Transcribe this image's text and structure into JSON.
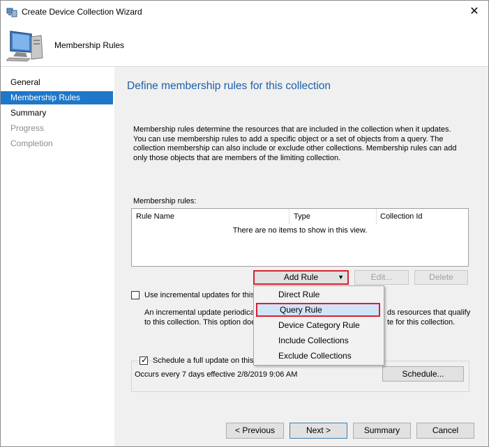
{
  "window": {
    "title": "Create Device Collection Wizard",
    "close_glyph": "✕"
  },
  "header": {
    "icon": "computer-icon",
    "title": "Membership Rules"
  },
  "nav": {
    "items": [
      {
        "label": "General",
        "state": "normal"
      },
      {
        "label": "Membership Rules",
        "state": "active"
      },
      {
        "label": "Summary",
        "state": "normal"
      },
      {
        "label": "Progress",
        "state": "disabled"
      },
      {
        "label": "Completion",
        "state": "disabled"
      }
    ]
  },
  "main": {
    "title": "Define membership rules for this collection",
    "description": "Membership rules determine the resources that are included in the collection when it updates. You can use membership rules to add a specific object or a set of objects from a query. The collection membership can also include or exclude other collections. Membership rules can add only those objects that are members of the limiting collection.",
    "rules_label": "Membership rules:",
    "columns": [
      "Rule Name",
      "Type",
      "Collection Id"
    ],
    "empty_text": "There are no items to show in this view.",
    "add_rule": "Add Rule",
    "edit": "Edit...",
    "delete": "Delete",
    "incremental_label": "Use incremental updates for this c",
    "incremental_desc_line1": "An incremental update periodical",
    "incremental_desc_line1_tail": "ds resources that qualify",
    "incremental_desc_line2": "to this collection. This option doe",
    "incremental_desc_line2_tail": "te for this collection.",
    "schedule_check_label": "Schedule a full update on this collection",
    "schedule_text": "Occurs every 7 days effective 2/8/2019 9:06 AM",
    "schedule_button": "Schedule..."
  },
  "menu": {
    "items": [
      "Direct Rule",
      "Query Rule",
      "Device Category Rule",
      "Include Collections",
      "Exclude Collections"
    ]
  },
  "footer": {
    "previous": "< Previous",
    "next": "Next >",
    "summary": "Summary",
    "cancel": "Cancel"
  },
  "colors": {
    "accent": "#1f77c9",
    "title_blue": "#1d5fa8",
    "highlight_red": "#d6212f",
    "panel": "#f0f0f0"
  }
}
